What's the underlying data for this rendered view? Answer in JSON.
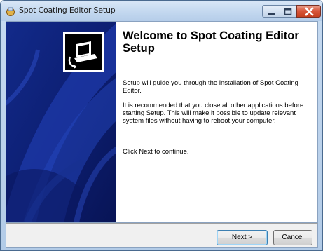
{
  "window": {
    "title": "Spot Coating Editor Setup"
  },
  "content": {
    "heading": "Welcome to Spot Coating Editor Setup",
    "paragraphs": [
      "Setup will guide you through the installation of Spot Coating Editor.",
      "It is recommended that you close all other applications before starting Setup. This will make it possible to update relevant system files without having to reboot your computer.",
      "Click Next to continue."
    ]
  },
  "buttons": {
    "next": "Next >",
    "cancel": "Cancel"
  },
  "colors": {
    "sidebar_dark": "#0b1a66",
    "sidebar_blue": "#1f3cb0",
    "close_red": "#c6401f"
  },
  "icons": {
    "app": "installer-icon",
    "sidebar": "installer-computer-icon",
    "minimize": "minimize-icon",
    "maximize": "maximize-icon",
    "close": "close-icon"
  }
}
